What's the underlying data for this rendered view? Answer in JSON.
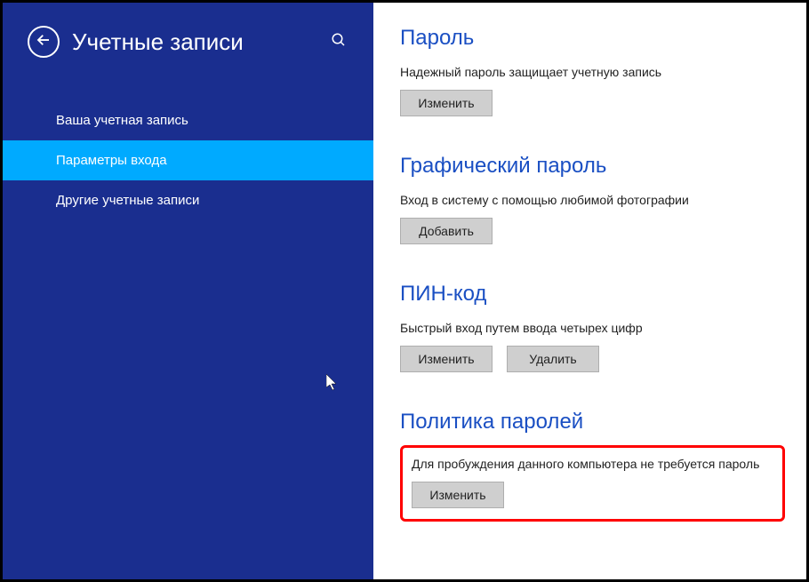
{
  "header": {
    "title": "Учетные записи"
  },
  "nav": {
    "items": [
      {
        "label": "Ваша учетная запись",
        "active": false
      },
      {
        "label": "Параметры входа",
        "active": true
      },
      {
        "label": "Другие учетные записи",
        "active": false
      }
    ]
  },
  "sections": {
    "password": {
      "title": "Пароль",
      "desc": "Надежный пароль защищает учетную запись",
      "change_btn": "Изменить"
    },
    "picture_password": {
      "title": "Графический пароль",
      "desc": "Вход в систему с помощью любимой фотографии",
      "add_btn": "Добавить"
    },
    "pin": {
      "title": "ПИН-код",
      "desc": "Быстрый вход путем ввода четырех цифр",
      "change_btn": "Изменить",
      "remove_btn": "Удалить"
    },
    "password_policy": {
      "title": "Политика паролей",
      "desc": "Для пробуждения данного компьютера не требуется пароль",
      "change_btn": "Изменить"
    }
  }
}
